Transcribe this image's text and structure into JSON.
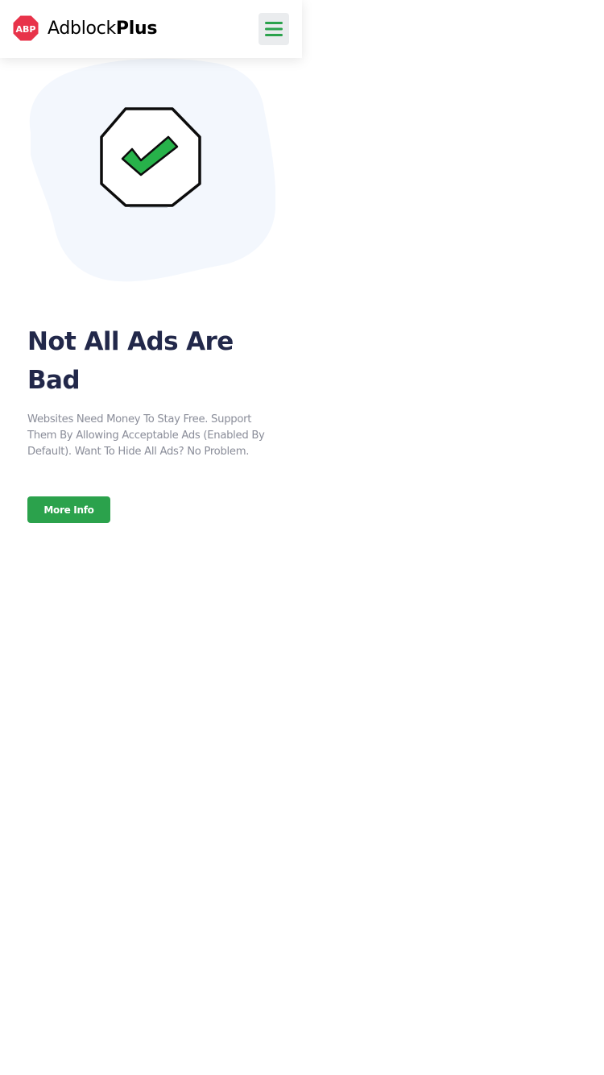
{
  "header": {
    "logo_badge_text": "ABP",
    "logo_text_light": "Adblock",
    "logo_text_bold": "Plus",
    "menu_icon": "hamburger-icon"
  },
  "hero": {
    "illustration_icon": "checkmark-octagon-icon",
    "title": "Not All Ads Are Bad",
    "description": "Websites Need Money To Stay Free. Support Them By Allowing Acceptable Ads (Enabled By Default). Want To Hide All Ads? No Problem.",
    "button_label": "More Info"
  },
  "colors": {
    "brand_red": "#e8334a",
    "accent_green": "#2ba24c",
    "check_green": "#27b24a",
    "title_navy": "#22284a",
    "body_gray": "#8a8d99",
    "menu_bg": "#eaecee",
    "blob_tint": "#f3f7fd"
  }
}
